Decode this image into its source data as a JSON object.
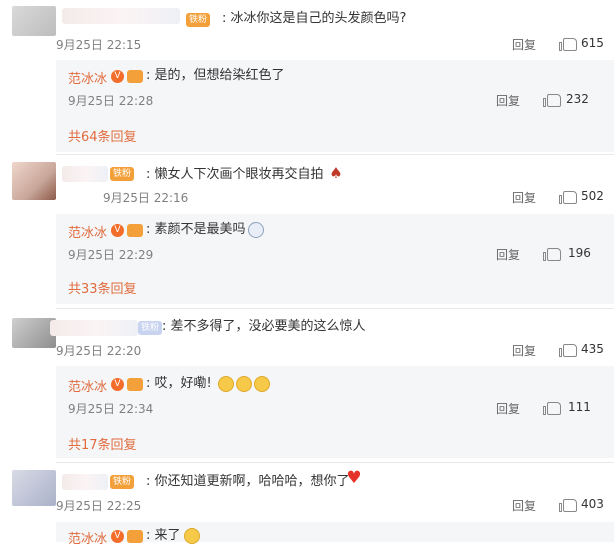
{
  "comments": [
    {
      "badge": "铁粉",
      "text": "冰冰你这是自己的头发颜色吗?",
      "time": "9月25日 22:15",
      "reply_label": "回复",
      "likes": "615",
      "reply": {
        "name": "范冰冰",
        "text": "是的，但想给染红色了",
        "time": "9月25日 22:28",
        "reply_label": "回复",
        "likes": "232"
      },
      "more": "共64条回复"
    },
    {
      "badge": "铁粉",
      "text": "懒女人下次画个眼妆再交自拍",
      "time": "9月25日 22:16",
      "reply_label": "回复",
      "likes": "502",
      "reply": {
        "name": "范冰冰",
        "text": "素颜不是最美吗",
        "time": "9月25日 22:29",
        "reply_label": "回复",
        "likes": "196"
      },
      "more": "共33条回复"
    },
    {
      "badge": "铁粉",
      "text": "差不多得了，没必要美的这么惊人",
      "time": "9月25日 22:20",
      "reply_label": "回复",
      "likes": "435",
      "reply": {
        "name": "范冰冰",
        "text": "哎，好嘞!",
        "time": "9月25日 22:34",
        "reply_label": "回复",
        "likes": "111"
      },
      "more": "共17条回复"
    },
    {
      "badge": "铁粉",
      "text": "你还知道更新啊，哈哈哈，想你了",
      "time": "9月25日 22:25",
      "reply_label": "回复",
      "likes": "403",
      "reply": {
        "name": "范冰冰",
        "text": "来了"
      }
    }
  ],
  "icons": {
    "like": "thumbs-up-icon",
    "verified": "v-icon",
    "crown": "crown-icon"
  },
  "colors": {
    "accent": "#e06b3d",
    "fan_badge": "#f3a03a",
    "reply_bg": "#f5f6f8"
  }
}
